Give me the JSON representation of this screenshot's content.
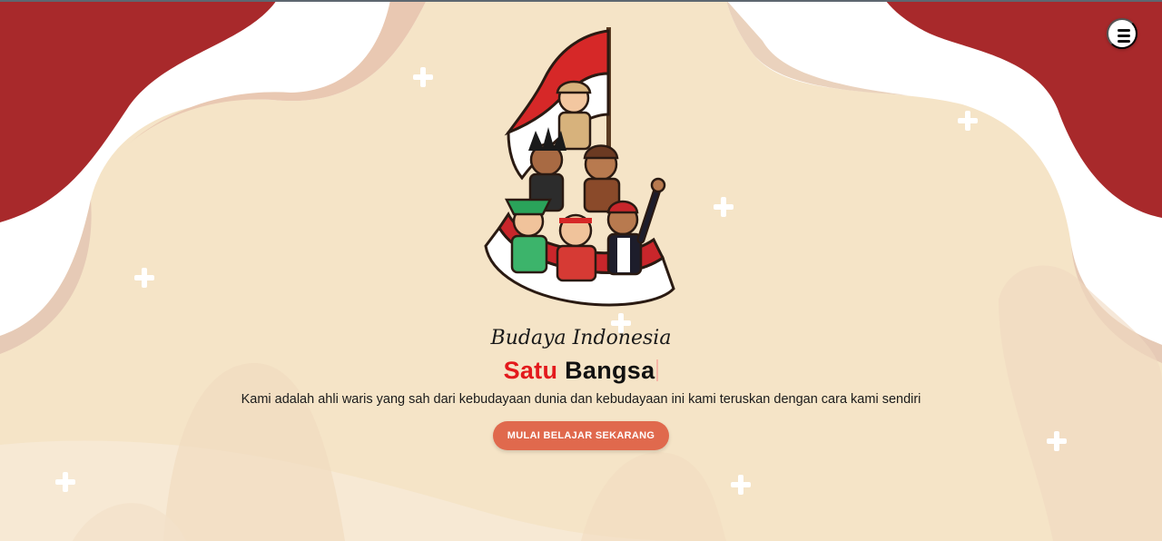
{
  "page": {
    "brand_title": "Budaya Indonesia",
    "headline": {
      "part1": "Satu",
      "part2": "Bangsa"
    },
    "tagline": "Kami adalah ahli waris yang sah dari kebudayaan dunia dan kebudayaan ini kami teruskan dengan cara kami sendiri",
    "cta_label": "MULAI BELAJAR SEKARANG"
  },
  "icons": {
    "menu": "hamburger-menu-icon",
    "hero": "indonesian-culture-group-illustration",
    "decor": "plus-sparkle-icon"
  },
  "colors": {
    "accent_red": "#e3191c",
    "corner_red": "#a8292b",
    "button": "#e0694d",
    "background": "#f5e4c7"
  }
}
